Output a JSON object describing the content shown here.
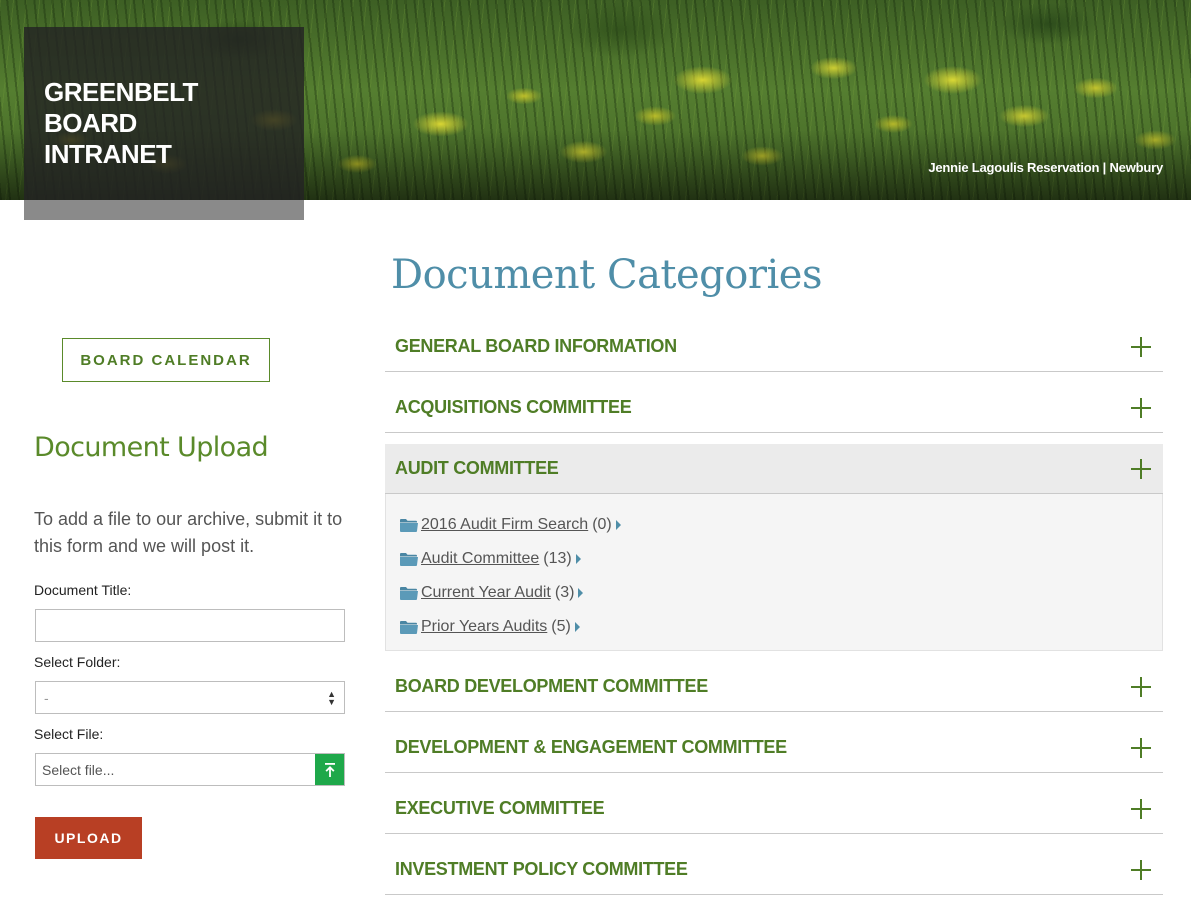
{
  "header": {
    "brand_title": "GREENBELT BOARD INTRANET",
    "photo_credit": "Jennie Lagoulis Reservation | Newbury"
  },
  "sidebar": {
    "calendar_button": "BOARD CALENDAR",
    "upload": {
      "heading": "Document Upload",
      "description": "To add a file to our archive, submit it to this form and we will post it.",
      "title_label": "Document Title:",
      "title_value": "",
      "folder_label": "Select Folder:",
      "folder_selected": "-",
      "file_label": "Select File:",
      "file_placeholder": "Select file...",
      "submit_label": "UPLOAD"
    }
  },
  "main": {
    "title": "Document Categories",
    "categories": [
      {
        "label": "GENERAL BOARD INFORMATION"
      },
      {
        "label": "ACQUISITIONS COMMITTEE"
      },
      {
        "label": "AUDIT COMMITTEE",
        "open": true,
        "folders": [
          {
            "name": "2016 Audit Firm Search",
            "count": "(0)"
          },
          {
            "name": "Audit Committee",
            "count": "(13)"
          },
          {
            "name": "Current Year Audit",
            "count": "(3)"
          },
          {
            "name": "Prior Years Audits",
            "count": "(5)"
          }
        ]
      },
      {
        "label": "BOARD DEVELOPMENT COMMITTEE"
      },
      {
        "label": "DEVELOPMENT & ENGAGEMENT COMMITTEE"
      },
      {
        "label": "EXECUTIVE COMMITTEE"
      },
      {
        "label": "INVESTMENT POLICY COMMITTEE"
      }
    ]
  },
  "colors": {
    "accent_green": "#4f7d26",
    "title_blue": "#4f8ea8",
    "upload_red": "#b83f24",
    "file_green": "#1ea84a"
  },
  "icons": {
    "expand": "plus-icon",
    "folder": "folder-icon",
    "caret": "caret-right-icon",
    "upload_arrow": "upload-arrow-icon",
    "select": "select-arrows-icon"
  }
}
